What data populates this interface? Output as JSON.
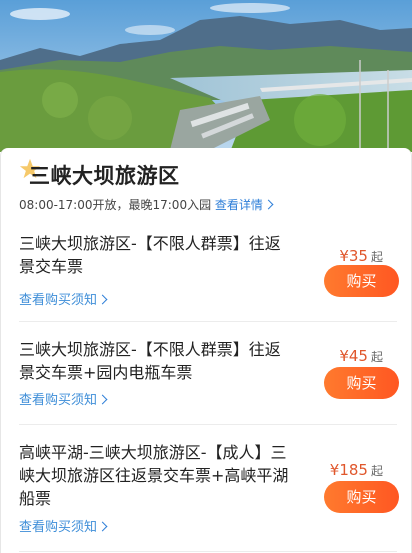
{
  "hero": {
    "image": "three-gorges-dam-landscape"
  },
  "scenic": {
    "title": "三峡大坝旅游区",
    "hours": "08:00-17:00开放，最晚17:00入园",
    "details_link": "查看详情"
  },
  "tickets": [
    {
      "name": "三峡大坝旅游区-【不限人群票】往返景交车票",
      "notice": "查看购买须知",
      "price": "¥35",
      "qi": "起",
      "buy": "购买"
    },
    {
      "name": "三峡大坝旅游区-【不限人群票】往返景交车票+园内电瓶车票",
      "notice": "查看购买须知",
      "price": "¥45",
      "qi": "起",
      "buy": "购买"
    },
    {
      "name": "高峡平湖-三峡大坝旅游区-【成人】三峡大坝旅游区往返景交车票+高峡平湖船票",
      "notice": "查看购买须知",
      "price": "¥185",
      "qi": "起",
      "buy": "购买"
    }
  ],
  "colors": {
    "accent": "#ff5722",
    "price": "#e0572c",
    "link": "#2f7fd8"
  }
}
